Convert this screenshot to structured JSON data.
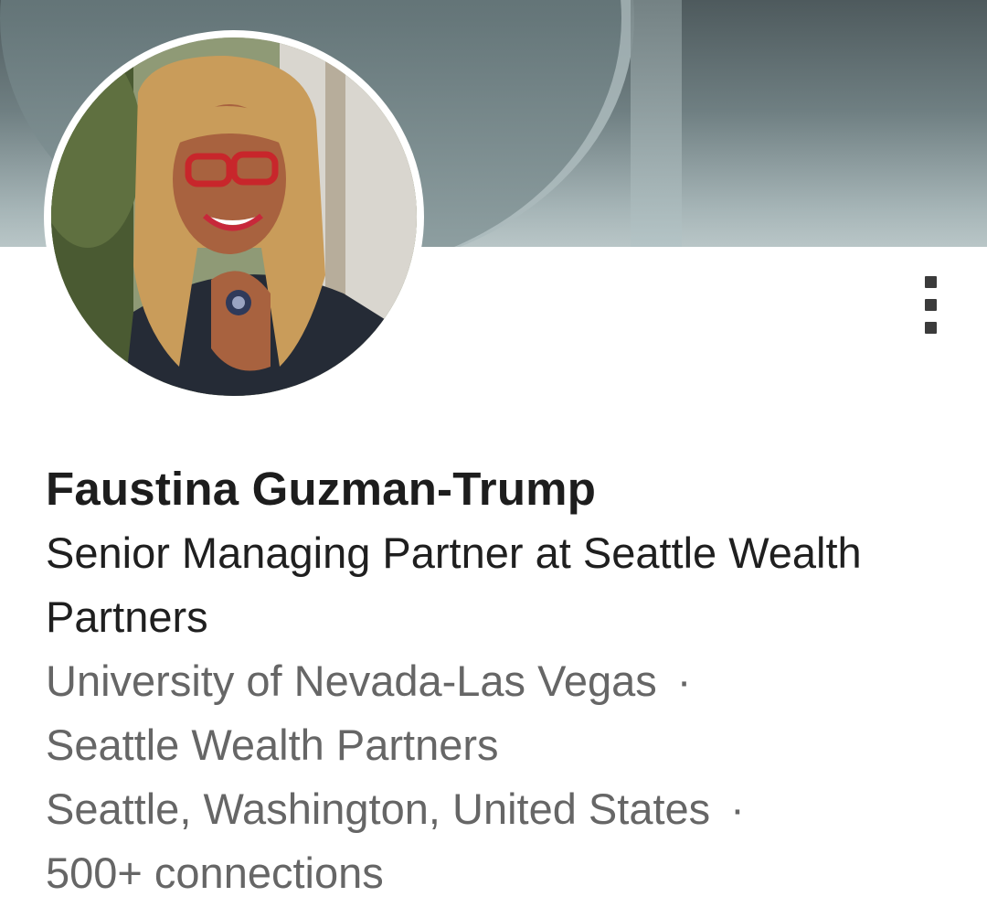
{
  "profile": {
    "name": "Faustina Guzman-Trump",
    "headline": "Senior Managing Partner at Seattle Wealth Partners",
    "education": "University of Nevada-Las Vegas",
    "separator": "·",
    "company": "Seattle Wealth Partners",
    "location": "Seattle, Washington, United States",
    "connections": "500+ connections"
  },
  "icons": {
    "more": "more-vertical-icon"
  },
  "colors": {
    "text_primary": "#1d1d1d",
    "text_secondary": "#666666",
    "cover_dark": "#4e5a5d",
    "cover_light": "#b9c6c7",
    "glasses": "#c8262b"
  }
}
